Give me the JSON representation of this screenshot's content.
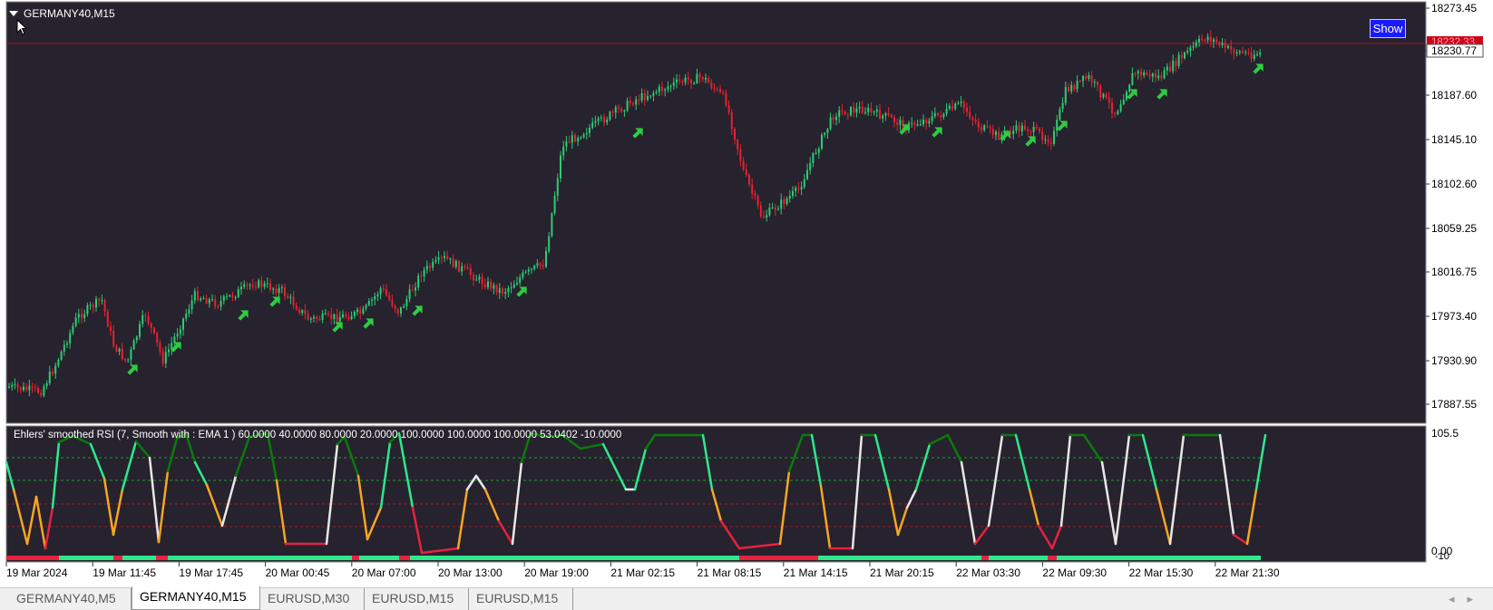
{
  "chart": {
    "symbol_title": "GERMANY40,M15",
    "show_button": "Show",
    "current_price": "18230.77",
    "current_price_overlay": "18232.33",
    "price_axis": [
      "18273.45",
      "18230.77",
      "18187.60",
      "18145.10",
      "18102.60",
      "18059.25",
      "18016.75",
      "17973.40",
      "17930.90",
      "17887.55"
    ],
    "time_axis": [
      "19 Mar 2024",
      "19 Mar 11:45",
      "19 Mar 17:45",
      "20 Mar 00:45",
      "20 Mar 07:00",
      "20 Mar 13:00",
      "20 Mar 19:00",
      "21 Mar 02:15",
      "21 Mar 08:15",
      "21 Mar 14:15",
      "21 Mar 20:15",
      "22 Mar 03:30",
      "22 Mar 09:30",
      "22 Mar 15:30",
      "22 Mar 21:30"
    ],
    "colors": {
      "background": "#26222e",
      "bull": "#2ecc71",
      "bear": "#e8212f",
      "arrow": "#2ecc40",
      "price_line": "#d0021b",
      "axis_bg": "#ffffff"
    }
  },
  "indicator": {
    "title": "Ehlers' smoothed RSI (7, Smooth with : EMA  1 ) 60.0000 40.0000 80.0000 20.0000 100.0000 100.0000 100.0000 53.0402 -10.0000",
    "axis_top": "105.5",
    "axis_bottom_a": "0.00",
    "axis_bottom_b": "-10"
  },
  "tabs": [
    "GERMANY40,M5",
    "GERMANY40,M15",
    "EURUSD,M30",
    "EURUSD,M15",
    "EURUSD,M15"
  ],
  "active_tab": 1,
  "icons": [
    "dropdown-triangle-icon",
    "mouse-cursor-icon",
    "scroll-left-icon",
    "scroll-right-icon"
  ]
}
